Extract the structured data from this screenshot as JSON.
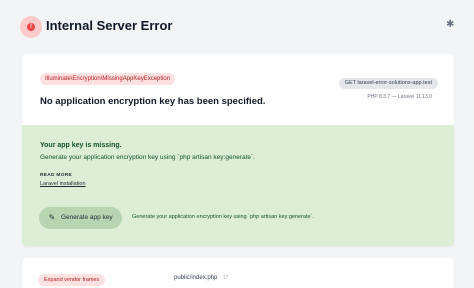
{
  "header": {
    "title": "Internal Server Error",
    "error_icon": "exclamation-icon",
    "settings_icon": "gear-icon"
  },
  "exception": {
    "class": "Illuminate\\Encryption\\MissingAppKeyException",
    "message": "No application encryption key has been specified.",
    "request": "GET laravel-error-solutions-app.test",
    "versions": "PHP 8.3.7 — Laravel 11.13.0"
  },
  "solution": {
    "title": "Your app key is missing.",
    "description": "Generate your application encryption key using `php artisan key:generate`.",
    "read_more_label": "READ MORE",
    "link_label": "Laravel installation",
    "button_label": "Generate app key",
    "button_icon": "wand-icon",
    "button_hint": "Generate your application encryption key using `php artisan key:generate`."
  },
  "stack": {
    "expand_label": "Expand vendor frames",
    "frame_file": "public/index.php",
    "frame_line": ": 17"
  },
  "colors": {
    "error_accent": "#ef4444",
    "solution_bg": "#dcefd6",
    "button_bg": "#b8d5b1"
  }
}
